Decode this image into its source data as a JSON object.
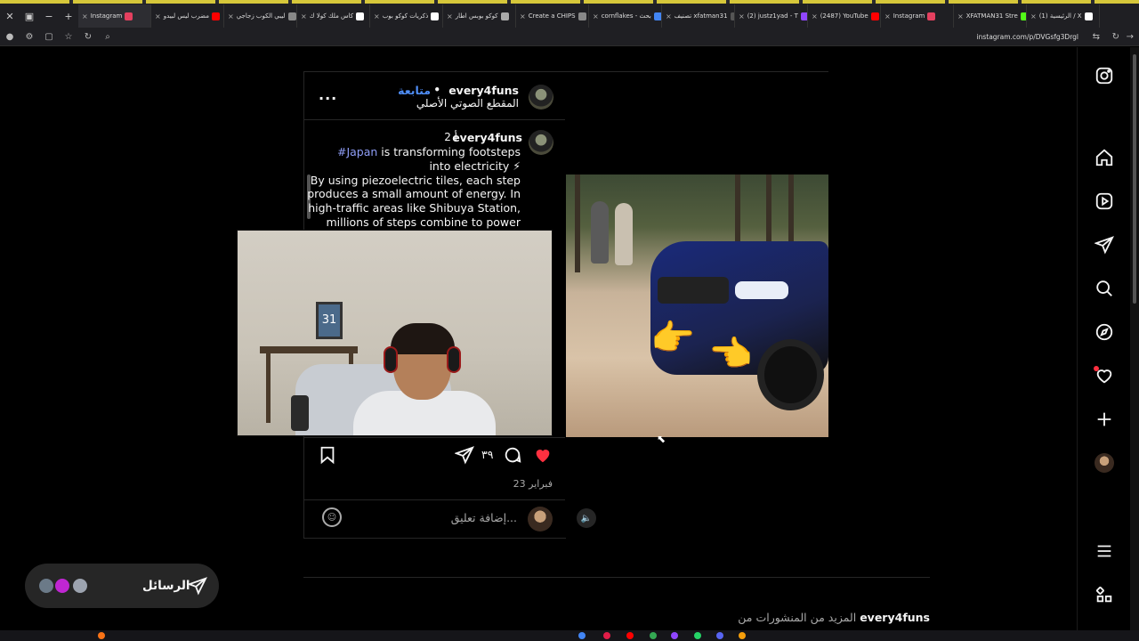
{
  "browser": {
    "tabs": [
      {
        "label": "Instagram",
        "color": "#e4405f",
        "active": true
      },
      {
        "label": "مضرب ليس لبيدو",
        "color": "#ff0000"
      },
      {
        "label": "ليبي الكوب زجاجي",
        "color": "#888888"
      },
      {
        "label": "كاس ملك كولا ك",
        "color": "#ffffff"
      },
      {
        "label": "ذكريات كوكو بوب",
        "color": "#ffffff"
      },
      {
        "label": "كوكو بوبس اطار",
        "color": "#aaaaaa"
      },
      {
        "label": "Create a CHIPS",
        "color": "#888888"
      },
      {
        "label": "cornflakes - بحث",
        "color": "#4285f4"
      },
      {
        "label": "تصنيف xfatman31",
        "color": "#555555"
      },
      {
        "label": "(2) justz1yad - T",
        "color": "#9146ff"
      },
      {
        "label": "(2487) YouTube",
        "color": "#ff0000"
      },
      {
        "label": "Instagram",
        "color": "#e4405f"
      },
      {
        "label": "XFATMAN31 Stre",
        "color": "#53fc18"
      },
      {
        "label": "(1) الرئيسية / X",
        "color": "#ffffff"
      }
    ],
    "url": "instagram.com/p/DVGsfg3Drgl"
  },
  "post": {
    "header": {
      "username": "every4funs",
      "follow_label": "متابعة",
      "separator": "•",
      "audio": "المقطع الصوتي الأصلي",
      "more_label": "..."
    },
    "caption": {
      "username": "every4funs",
      "time": "2 أ",
      "hashtag": "#Japan",
      "lines": [
        "is transforming footsteps",
        "into electricity ⚡",
        "By using piezoelectric tiles, each step",
        "produces a small amount of energy. In",
        "high-traffic areas like Shibuya Station,",
        "millions of steps combine to power"
      ]
    },
    "actions": {
      "comment_count": "٣٩",
      "date": "23 فبراير"
    },
    "comment_placeholder": "إضافة تعليق...",
    "webcam_frame_number": "31"
  },
  "more_posts": {
    "prefix": "المزيد من المنشورات من",
    "username": "every4funs"
  },
  "messages": {
    "label": "الرسائل"
  },
  "colors": {
    "background": "#000000",
    "link": "#4f8ef7",
    "hashtag": "#8f9ef7",
    "like": "#ff3040",
    "muted_text": "#a8a8a8",
    "border": "#262626"
  },
  "icons": {
    "rail": [
      "instagram-icon",
      "home-icon",
      "reels-icon",
      "direct-icon",
      "search-icon",
      "explore-icon",
      "notifications-icon",
      "create-icon",
      "profile-avatar",
      "menu-icon",
      "apps-icon"
    ]
  }
}
